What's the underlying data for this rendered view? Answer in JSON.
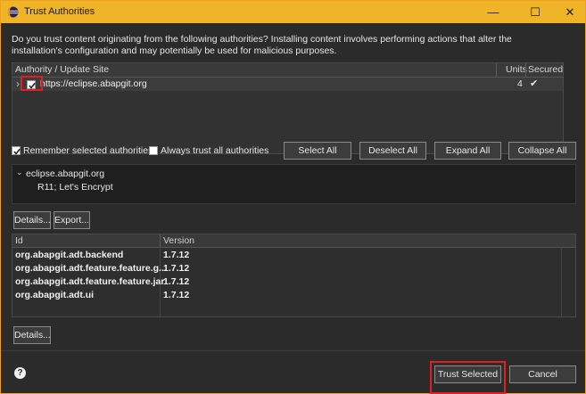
{
  "window": {
    "title": "Trust Authorities",
    "minimize": "—",
    "maximize": "☐",
    "close": "✕"
  },
  "intro": "Do you trust content originating from the following authorities?  Installing content involves performing actions that alter the installation's configuration and may potentially be used for malicious purposes.",
  "authorities_table": {
    "headers": {
      "site": "Authority / Update Site",
      "units": "Units",
      "secured": "Secured"
    },
    "rows": [
      {
        "expand": "›",
        "checked": true,
        "site": "https://eclipse.abapgit.org",
        "units": "4",
        "secured": "✔"
      }
    ]
  },
  "options": {
    "remember_label": "Remember selected authorities",
    "remember_checked": true,
    "always_trust_label": "Always trust all authorities",
    "always_trust_checked": false
  },
  "buttons": {
    "select_all": "Select All",
    "deselect_all": "Deselect All",
    "expand_all": "Expand All",
    "collapse_all": "Collapse All",
    "details": "Details...",
    "export": "Export...",
    "details2": "Details...",
    "trust_selected": "Trust Selected",
    "cancel": "Cancel",
    "help": "?"
  },
  "certificate_tree": {
    "root_label": "eclipse.abapgit.org",
    "child_label": "R11; Let's Encrypt"
  },
  "units_table": {
    "headers": {
      "id": "Id",
      "version": "Version"
    },
    "rows": [
      {
        "id": "org.abapgit.adt.backend",
        "version": "1.7.12"
      },
      {
        "id": "org.abapgit.adt.feature.feature.g...",
        "version": "1.7.12"
      },
      {
        "id": "org.abapgit.adt.feature.feature.jar",
        "version": "1.7.12"
      },
      {
        "id": "org.abapgit.adt.ui",
        "version": "1.7.12"
      }
    ]
  },
  "colors": {
    "titlebar": "#f0b429",
    "highlight": "#e02020",
    "background": "#2b2b2b"
  }
}
